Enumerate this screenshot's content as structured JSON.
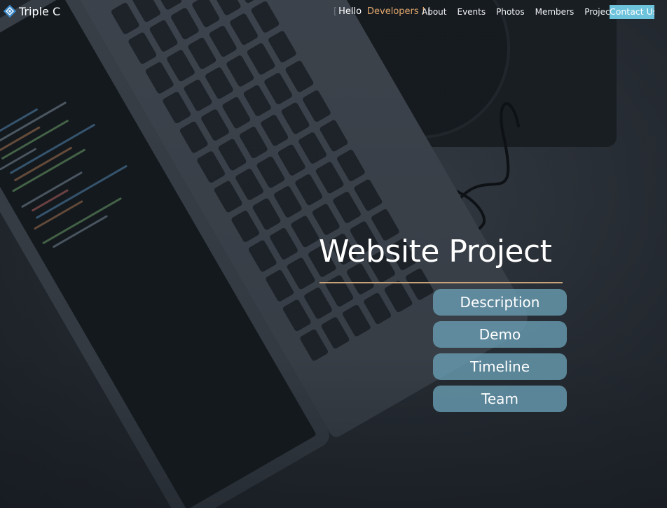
{
  "brand": {
    "name": "Triple C",
    "logo_icon": "diamond-logo-icon"
  },
  "greeting": {
    "open_bracket": "[",
    "hello": "Hello",
    "developers": "Developers !",
    "close_bracket": "]"
  },
  "nav": {
    "items": [
      {
        "label": "About"
      },
      {
        "label": "Events"
      },
      {
        "label": "Photos"
      },
      {
        "label": "Members"
      },
      {
        "label": "Projects",
        "icon": "chevron-down-icon"
      }
    ],
    "contact_label": "Contact Us"
  },
  "hero": {
    "title": "Website Project",
    "buttons": [
      {
        "label": "Description"
      },
      {
        "label": "Demo"
      },
      {
        "label": "Timeline"
      },
      {
        "label": "Team"
      }
    ]
  },
  "colors": {
    "accent": "#e2a96c",
    "contact_bg": "#6ec3dc",
    "hero_button_bg": "#6aa0b6",
    "divider": "#c8a27a"
  }
}
